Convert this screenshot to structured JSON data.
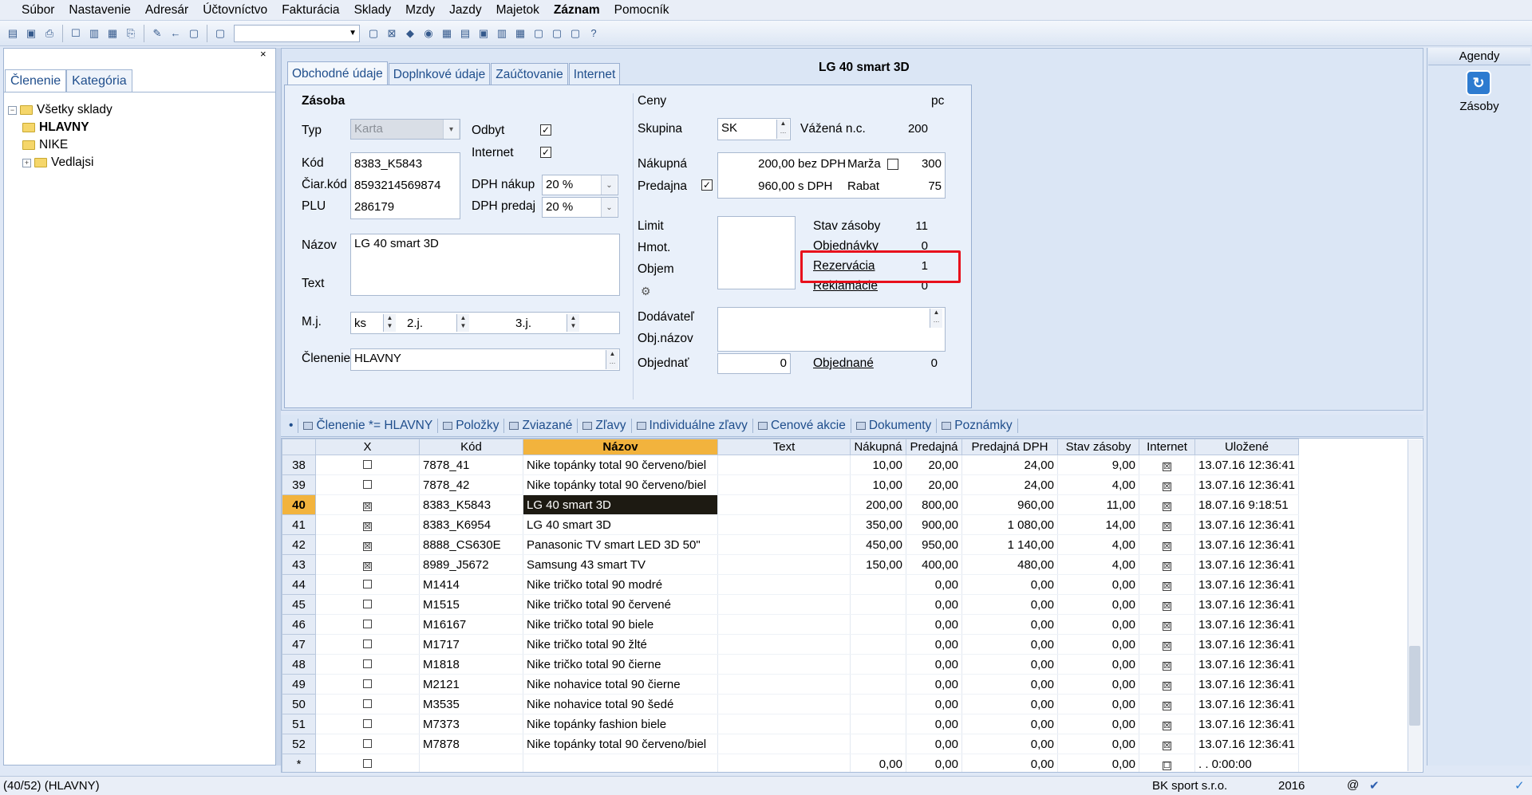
{
  "menu": [
    "Súbor",
    "Nastavenie",
    "Adresár",
    "Účtovníctvo",
    "Fakturácia",
    "Sklady",
    "Mzdy",
    "Jazdy",
    "Majetok",
    "Záznam",
    "Pomocník"
  ],
  "menu_bold_index": 9,
  "left": {
    "close": "×",
    "tabs": [
      "Členenie",
      "Kategória"
    ],
    "tree": [
      {
        "label": "Všetky sklady",
        "level": 0,
        "expander": "−"
      },
      {
        "label": "HLAVNY",
        "level": 1,
        "bold": true
      },
      {
        "label": "NIKE",
        "level": 1
      },
      {
        "label": "Vedlajsi",
        "level": 1,
        "expander": "+"
      }
    ]
  },
  "form": {
    "tabs": [
      "Obchodné údaje",
      "Doplnkové údaje",
      "Zaúčtovanie",
      "Internet"
    ],
    "title": "LG 40 smart 3D",
    "section_zasoba": "Zásoba",
    "typ_label": "Typ",
    "typ_value": "Karta",
    "odbyt_label": "Odbyt",
    "odbyt_checked": "✓",
    "internet_label": "Internet",
    "internet_checked": "✓",
    "kod_label": "Kód",
    "kod_value": "8383_K5843",
    "ciarkod_label": "Čiar.kód",
    "ciarkod_value": "8593214569874",
    "plu_label": "PLU",
    "plu_value": "286179",
    "dph_nakup_label": "DPH nákup",
    "dph_nakup_value": "20 %",
    "dph_predaj_label": "DPH predaj",
    "dph_predaj_value": "20 %",
    "nazov_label": "Názov",
    "nazov_value": "LG 40 smart 3D",
    "text_label": "Text",
    "mj_label": "M.j.",
    "mj_value": "ks",
    "mj2_label": "2.j.",
    "mj3_label": "3.j.",
    "clenenie_label": "Členenie",
    "clenenie_value": "HLAVNY",
    "ceny_label": "Ceny",
    "unit_pc": "pc",
    "skupina_label": "Skupina",
    "skupina_value": "SK",
    "vazena_label": "Vážená n.c.",
    "vazena_value": "200",
    "nakupna_label": "Nákupná",
    "nakupna_value": "200,00",
    "bez_dph": "bez DPH",
    "marza_label": "Marža",
    "marza_value": "300",
    "predajna_label": "Predajna",
    "predajna_checked": "✓",
    "predajna_value": "960,00",
    "s_dph": "s DPH",
    "rabat_label": "Rabat",
    "rabat_value": "75",
    "limit_label": "Limit",
    "hmot_label": "Hmot.",
    "objem_label": "Objem",
    "stav_label": "Stav zásoby",
    "stav_value": "11",
    "objednavky_label": "Objednávky",
    "objednavky_value": "0",
    "rezervacia_label": "Rezervácia",
    "rezervacia_value": "1",
    "reklamacie_label": "Reklamácie",
    "reklamacie_value": "0",
    "dodavatel_label": "Dodávateľ",
    "objnazov_label": "Obj.názov",
    "objednat_label": "Objednať",
    "objednat_value": "0",
    "objednane_label": "Objednané",
    "objednane_value": "0"
  },
  "agendy": {
    "header": "Agendy",
    "item": "Zásoby",
    "icon": "zasoby-icon"
  },
  "grid_tabs": [
    "Členenie *= HLAVNY",
    "Položky",
    "Zviazané",
    "Zľavy",
    "Individuálne zľavy",
    "Cenové akcie",
    "Dokumenty",
    "Poznámky"
  ],
  "grid": {
    "columns": [
      "",
      "X",
      "Kód",
      "Názov",
      "Text",
      "Nákupná",
      "Predajná",
      "Predajná DPH",
      "Stav zásoby",
      "Internet",
      "Uložené"
    ],
    "rows": [
      {
        "n": "38",
        "x": "",
        "kod": "7878_41",
        "nazov": "Nike topánky total 90 červeno/biel",
        "text": "",
        "nak": "10,00",
        "pred": "20,00",
        "pdph": "24,00",
        "stav": "9,00",
        "inet": "☒",
        "ulozene": "13.07.16 12:36:41"
      },
      {
        "n": "39",
        "x": "",
        "kod": "7878_42",
        "nazov": "Nike topánky total 90 červeno/biel",
        "text": "",
        "nak": "10,00",
        "pred": "20,00",
        "pdph": "24,00",
        "stav": "4,00",
        "inet": "☒",
        "ulozene": "13.07.16 12:36:41"
      },
      {
        "n": "40",
        "x": "☒",
        "kod": "8383_K5843",
        "nazov": "LG 40 smart 3D",
        "text": "",
        "nak": "200,00",
        "pred": "800,00",
        "pdph": "960,00",
        "stav": "11,00",
        "inet": "☒",
        "ulozene": "18.07.16 9:18:51",
        "current": true
      },
      {
        "n": "41",
        "x": "☒",
        "kod": "8383_K6954",
        "nazov": "LG 40 smart 3D",
        "text": "",
        "nak": "350,00",
        "pred": "900,00",
        "pdph": "1 080,00",
        "stav": "14,00",
        "inet": "☒",
        "ulozene": "13.07.16 12:36:41"
      },
      {
        "n": "42",
        "x": "☒",
        "kod": "8888_CS630E",
        "nazov": "Panasonic TV smart LED 3D 50\"",
        "text": "",
        "nak": "450,00",
        "pred": "950,00",
        "pdph": "1 140,00",
        "stav": "4,00",
        "inet": "☒",
        "ulozene": "13.07.16 12:36:41"
      },
      {
        "n": "43",
        "x": "☒",
        "kod": "8989_J5672",
        "nazov": "Samsung 43 smart TV",
        "text": "",
        "nak": "150,00",
        "pred": "400,00",
        "pdph": "480,00",
        "stav": "4,00",
        "inet": "☒",
        "ulozene": "13.07.16 12:36:41"
      },
      {
        "n": "44",
        "x": "",
        "kod": "M1414",
        "nazov": "Nike tričko total 90 modré",
        "text": "",
        "nak": "",
        "pred": "0,00",
        "pdph": "0,00",
        "stav": "0,00",
        "inet": "☒",
        "ulozene": "13.07.16 12:36:41"
      },
      {
        "n": "45",
        "x": "",
        "kod": "M1515",
        "nazov": "Nike tričko total 90 červené",
        "text": "",
        "nak": "",
        "pred": "0,00",
        "pdph": "0,00",
        "stav": "0,00",
        "inet": "☒",
        "ulozene": "13.07.16 12:36:41"
      },
      {
        "n": "46",
        "x": "",
        "kod": "M16167",
        "nazov": "Nike tričko total 90 biele",
        "text": "",
        "nak": "",
        "pred": "0,00",
        "pdph": "0,00",
        "stav": "0,00",
        "inet": "☒",
        "ulozene": "13.07.16 12:36:41"
      },
      {
        "n": "47",
        "x": "",
        "kod": "M1717",
        "nazov": "Nike tričko total 90 žlté",
        "text": "",
        "nak": "",
        "pred": "0,00",
        "pdph": "0,00",
        "stav": "0,00",
        "inet": "☒",
        "ulozene": "13.07.16 12:36:41"
      },
      {
        "n": "48",
        "x": "",
        "kod": "M1818",
        "nazov": "Nike tričko total 90 čierne",
        "text": "",
        "nak": "",
        "pred": "0,00",
        "pdph": "0,00",
        "stav": "0,00",
        "inet": "☒",
        "ulozene": "13.07.16 12:36:41"
      },
      {
        "n": "49",
        "x": "",
        "kod": "M2121",
        "nazov": "Nike nohavice total 90 čierne",
        "text": "",
        "nak": "",
        "pred": "0,00",
        "pdph": "0,00",
        "stav": "0,00",
        "inet": "☒",
        "ulozene": "13.07.16 12:36:41"
      },
      {
        "n": "50",
        "x": "",
        "kod": "M3535",
        "nazov": "Nike nohavice total 90 šedé",
        "text": "",
        "nak": "",
        "pred": "0,00",
        "pdph": "0,00",
        "stav": "0,00",
        "inet": "☒",
        "ulozene": "13.07.16 12:36:41"
      },
      {
        "n": "51",
        "x": "",
        "kod": "M7373",
        "nazov": "Nike topánky fashion biele",
        "text": "",
        "nak": "",
        "pred": "0,00",
        "pdph": "0,00",
        "stav": "0,00",
        "inet": "☒",
        "ulozene": "13.07.16 12:36:41"
      },
      {
        "n": "52",
        "x": "",
        "kod": "M7878",
        "nazov": "Nike topánky total 90 červeno/biel",
        "text": "",
        "nak": "",
        "pred": "0,00",
        "pdph": "0,00",
        "stav": "0,00",
        "inet": "☒",
        "ulozene": "13.07.16 12:36:41"
      },
      {
        "n": "*",
        "x": "",
        "kod": "",
        "nazov": "",
        "text": "",
        "nak": "0,00",
        "pred": "0,00",
        "pdph": "0,00",
        "stav": "0,00",
        "inet": "☐",
        "ulozene": ". .   0:00:00"
      }
    ]
  },
  "status": {
    "left": "(40/52) (HLAVNY)",
    "company": "BK sport  s.r.o.",
    "year": "2016",
    "at": "@"
  },
  "colors": {
    "highlight": "#e8101c",
    "sorted_header": "#f2b33d",
    "current_row": "#1d1a12"
  }
}
